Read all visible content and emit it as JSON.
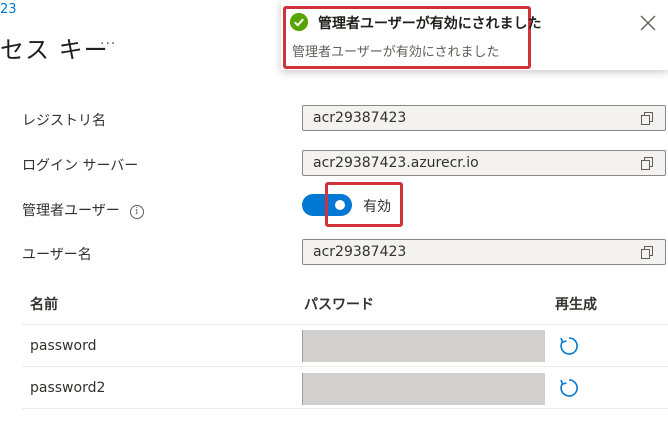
{
  "breadcrumb": "23",
  "page": {
    "title": "セス キー",
    "more": "···"
  },
  "fields": {
    "registry_name": {
      "label": "レジストリ名",
      "value": "acr29387423"
    },
    "login_server": {
      "label": "ログイン サーバー",
      "value": "acr29387423.azurecr.io"
    },
    "admin_user": {
      "label": "管理者ユーザー",
      "toggle_text": "有効",
      "enabled": true
    },
    "username": {
      "label": "ユーザー名",
      "value": "acr29387423"
    }
  },
  "table": {
    "headers": {
      "name": "名前",
      "password": "パスワード",
      "regenerate": "再生成"
    },
    "rows": [
      {
        "name": "password"
      },
      {
        "name": "password2"
      }
    ]
  },
  "toast": {
    "title": "管理者ユーザーが有効にされました",
    "message": "管理者ユーザーが有効にされました"
  },
  "colors": {
    "accent": "#0078d4",
    "highlight": "#d13438",
    "success": "#57a300"
  },
  "icons": [
    "info-icon",
    "copy-icon",
    "refresh-icon",
    "check-circle-icon",
    "close-icon"
  ]
}
